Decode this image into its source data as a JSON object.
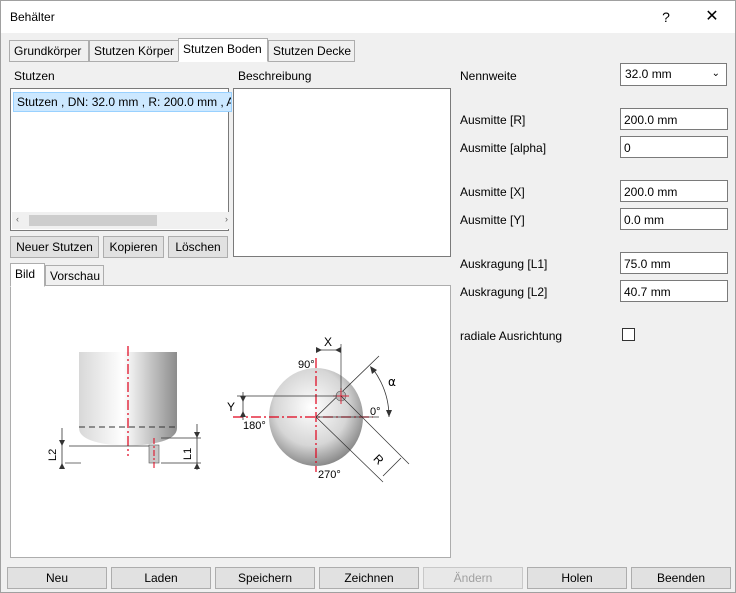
{
  "window": {
    "title": "Behälter",
    "help": "?",
    "close": "✕"
  },
  "tabs": [
    "Grundkörper",
    "Stutzen Körper",
    "Stutzen Boden",
    "Stutzen Decke"
  ],
  "left": {
    "stutzen_label": "Stutzen",
    "beschreibung_label": "Beschreibung",
    "list_items": [
      "Stutzen , DN: 32.0 mm , R: 200.0 mm , A"
    ],
    "buttons": {
      "neu": "Neuer Stutzen",
      "kopieren": "Kopieren",
      "loeschen": "Löschen"
    },
    "image_tabs": [
      "Bild",
      "Vorschau"
    ]
  },
  "diagram": {
    "labels": {
      "x": "X",
      "y": "Y",
      "deg90": "90°",
      "deg180": "180°",
      "deg270": "270°",
      "deg0": "0°",
      "alpha": "α",
      "r": "R",
      "l1": "L1",
      "l2": "L2"
    }
  },
  "right": {
    "nennweite_label": "Nennweite",
    "nennweite_value": "32.0 mm",
    "ausmitte_r_label": "Ausmitte [R]",
    "ausmitte_r_value": "200.0 mm",
    "ausmitte_alpha_label": "Ausmitte [alpha]",
    "ausmitte_alpha_value": "0",
    "ausmitte_x_label": "Ausmitte [X]",
    "ausmitte_x_value": "200.0 mm",
    "ausmitte_y_label": "Ausmitte [Y]",
    "ausmitte_y_value": "0.0 mm",
    "auskragung_l1_label": "Auskragung [L1]",
    "auskragung_l1_value": "75.0 mm",
    "auskragung_l2_label": "Auskragung [L2]",
    "auskragung_l2_value": "40.7 mm",
    "radiale_label": "radiale Ausrichtung"
  },
  "bottom_buttons": {
    "neu": "Neu",
    "laden": "Laden",
    "speichern": "Speichern",
    "zeichnen": "Zeichnen",
    "aendern": "Ändern",
    "holen": "Holen",
    "beenden": "Beenden"
  }
}
